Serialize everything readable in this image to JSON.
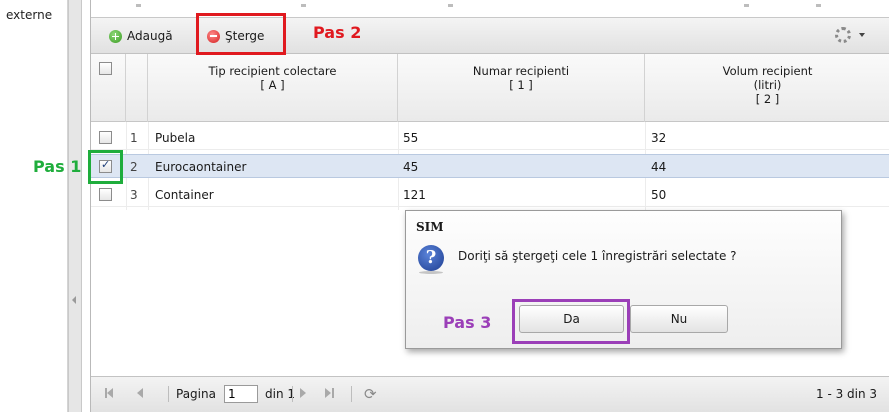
{
  "left_panel": {
    "label": "externe"
  },
  "toolbar": {
    "add_label": "Adaugă",
    "delete_label": "Şterge",
    "settings_icon": "gear-icon"
  },
  "grid": {
    "columns": [
      {
        "title": "Tip recipient colectare",
        "code": "[ A ]"
      },
      {
        "title": "Numar recipienti",
        "code": "[ 1 ]"
      },
      {
        "title": "Volum recipient",
        "subtitle": "(litri)",
        "code": "[ 2 ]"
      }
    ],
    "rows": [
      {
        "num": "1",
        "type": "Pubela",
        "count": "55",
        "volume": "32",
        "checked": false
      },
      {
        "num": "2",
        "type": "Eurocaontainer",
        "count": "45",
        "volume": "44",
        "checked": true
      },
      {
        "num": "3",
        "type": "Container",
        "count": "121",
        "volume": "50",
        "checked": false
      }
    ]
  },
  "paging": {
    "page_label": "Pagina",
    "page_value": "1",
    "of_label": "din 1",
    "summary": "1 - 3 din 3"
  },
  "dialog": {
    "title": "SIM",
    "message": "Doriţi să ştergeţi cele 1 înregistrări selectate ?",
    "yes_label": "Da",
    "no_label": "Nu"
  },
  "annotations": {
    "step1": "Pas 1",
    "step2": "Pas 2",
    "step3": "Pas 3"
  },
  "colors": {
    "step1": "#1fad3c",
    "step2": "#e0191f",
    "step3": "#9b3fb8",
    "selected_row": "#dde6f3"
  }
}
